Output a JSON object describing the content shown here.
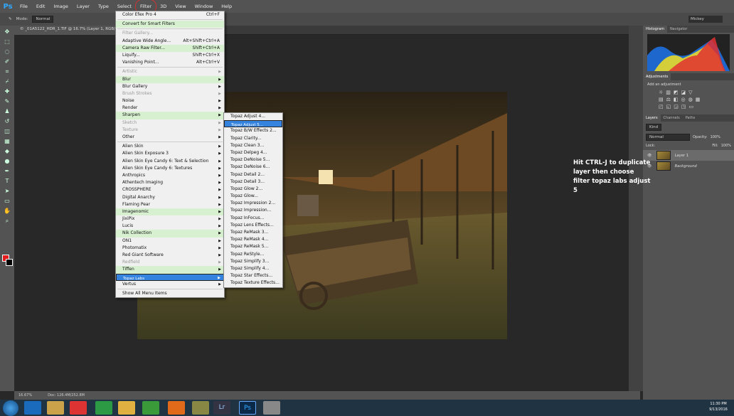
{
  "app": {
    "logo": "Ps"
  },
  "menubar": [
    "File",
    "Edit",
    "Image",
    "Layer",
    "Type",
    "Select",
    "Filter",
    "3D",
    "View",
    "Window",
    "Help"
  ],
  "options": {
    "mode_label": "Mode:",
    "mode_value": "Normal"
  },
  "workspace": "Mickey",
  "doc_tab": "© _01A5122_HDR_1.TIF @ 16.7% (Layer 1, RGB/8*)",
  "status": {
    "zoom": "16.67%",
    "doc": "Doc: 126.4M/252.8M"
  },
  "filter_menu": [
    {
      "label": "Color Efex Pro 4",
      "shortcut": "Ctrl+F",
      "state": "normal"
    },
    {
      "sep": true
    },
    {
      "label": "Convert for Smart Filters",
      "state": "hl"
    },
    {
      "sep": true
    },
    {
      "label": "Filter Gallery...",
      "state": "dis"
    },
    {
      "label": "Adaptive Wide Angle...",
      "shortcut": "Alt+Shift+Ctrl+A",
      "state": "normal"
    },
    {
      "label": "Camera Raw Filter...",
      "shortcut": "Shift+Ctrl+A",
      "state": "hl"
    },
    {
      "label": "Liquify...",
      "shortcut": "Shift+Ctrl+X",
      "state": "normal"
    },
    {
      "label": "Vanishing Point...",
      "shortcut": "Alt+Ctrl+V",
      "state": "normal"
    },
    {
      "sep": true
    },
    {
      "label": "Artistic",
      "arrow": true,
      "state": "dis"
    },
    {
      "label": "Blur",
      "arrow": true,
      "state": "hl"
    },
    {
      "label": "Blur Gallery",
      "arrow": true,
      "state": "normal"
    },
    {
      "label": "Brush Strokes",
      "arrow": true,
      "state": "dis"
    },
    {
      "label": "Noise",
      "arrow": true,
      "state": "normal"
    },
    {
      "label": "Render",
      "arrow": true,
      "state": "normal"
    },
    {
      "label": "Sharpen",
      "arrow": true,
      "state": "hl"
    },
    {
      "label": "Sketch",
      "arrow": true,
      "state": "dis"
    },
    {
      "label": "Texture",
      "arrow": true,
      "state": "dis"
    },
    {
      "label": "Other",
      "arrow": true,
      "state": "normal"
    },
    {
      "sep": true
    },
    {
      "label": "Alien Skin",
      "arrow": true,
      "state": "normal"
    },
    {
      "label": "Alien Skin Exposure 3",
      "arrow": true,
      "state": "normal"
    },
    {
      "label": "Alien Skin Eye Candy 6: Text & Selection",
      "arrow": true,
      "state": "normal"
    },
    {
      "label": "Alien Skin Eye Candy 6: Textures",
      "arrow": true,
      "state": "normal"
    },
    {
      "label": "Anthropics",
      "arrow": true,
      "state": "normal"
    },
    {
      "label": "Athentech Imaging",
      "arrow": true,
      "state": "normal"
    },
    {
      "label": "CROSSPHERE",
      "arrow": true,
      "state": "normal"
    },
    {
      "label": "Digital Anarchy",
      "arrow": true,
      "state": "normal"
    },
    {
      "label": "Flaming Pear",
      "arrow": true,
      "state": "normal"
    },
    {
      "label": "Imagenomic",
      "arrow": true,
      "state": "hl"
    },
    {
      "label": "JixiPix",
      "arrow": true,
      "state": "normal"
    },
    {
      "label": "Lucis",
      "arrow": true,
      "state": "normal"
    },
    {
      "label": "Nik Collection",
      "arrow": true,
      "state": "hl"
    },
    {
      "label": "ON1",
      "arrow": true,
      "state": "normal"
    },
    {
      "label": "Photomatix",
      "arrow": true,
      "state": "normal"
    },
    {
      "label": "Red Giant Software",
      "arrow": true,
      "state": "normal"
    },
    {
      "label": "Redfield",
      "arrow": true,
      "state": "dis"
    },
    {
      "label": "Tiffen",
      "arrow": true,
      "state": "hl"
    },
    {
      "label": "Topaz Labs",
      "arrow": true,
      "state": "sel"
    },
    {
      "label": "Vertus",
      "arrow": true,
      "state": "normal"
    },
    {
      "sep": true
    },
    {
      "label": "Show All Menu Items",
      "state": "normal"
    }
  ],
  "topaz_menu": [
    {
      "label": "Topaz Adjust 4...",
      "state": "normal"
    },
    {
      "label": "Topaz Adjust 5...",
      "state": "sel"
    },
    {
      "label": "Topaz B/W Effects 2...",
      "state": "normal"
    },
    {
      "label": "Topaz Clarity...",
      "state": "normal"
    },
    {
      "label": "Topaz Clean 3...",
      "state": "normal"
    },
    {
      "label": "Topaz Delpeg 4...",
      "state": "normal"
    },
    {
      "label": "Topaz DeNoise 5...",
      "state": "normal"
    },
    {
      "label": "Topaz DeNoise 6...",
      "state": "normal"
    },
    {
      "label": "Topaz Detail 2...",
      "state": "normal"
    },
    {
      "label": "Topaz Detail 3...",
      "state": "normal"
    },
    {
      "label": "Topaz Glow 2...",
      "state": "normal"
    },
    {
      "label": "Topaz Glow...",
      "state": "normal"
    },
    {
      "label": "Topaz Impression 2...",
      "state": "normal"
    },
    {
      "label": "Topaz Impression...",
      "state": "normal"
    },
    {
      "label": "Topaz InFocus...",
      "state": "normal"
    },
    {
      "label": "Topaz Lens Effects...",
      "state": "normal"
    },
    {
      "label": "Topaz ReMask 3...",
      "state": "normal"
    },
    {
      "label": "Topaz ReMask 4...",
      "state": "normal"
    },
    {
      "label": "Topaz ReMask 5...",
      "state": "normal"
    },
    {
      "label": "Topaz ReStyle...",
      "state": "normal"
    },
    {
      "label": "Topaz Simplify 3...",
      "state": "normal"
    },
    {
      "label": "Topaz Simplify 4...",
      "state": "normal"
    },
    {
      "label": "Topaz Star Effects...",
      "state": "normal"
    },
    {
      "label": "Topaz Texture Effects...",
      "state": "normal"
    }
  ],
  "note": "Hit CTRL-J to duplicate layer then choose filter topaz labs adjust 5",
  "panels": {
    "top_tabs": [
      "Histogram",
      "Navigator"
    ],
    "adjustments_title": "Adjustments",
    "add_adjustment": "Add an adjustment",
    "layer_tabs": [
      "Layers",
      "Channels",
      "Paths"
    ],
    "kind": "Kind",
    "blend": "Normal",
    "opacity_label": "Opacity:",
    "opacity": "100%",
    "lock_label": "Lock:",
    "fill_label": "Fill:",
    "fill": "100%",
    "layers": [
      "Layer 1",
      "Background"
    ]
  },
  "clock": {
    "time": "11:30 PM",
    "date": "9/13/2016"
  },
  "taskbar_apps": [
    "Lr",
    "Ps"
  ]
}
